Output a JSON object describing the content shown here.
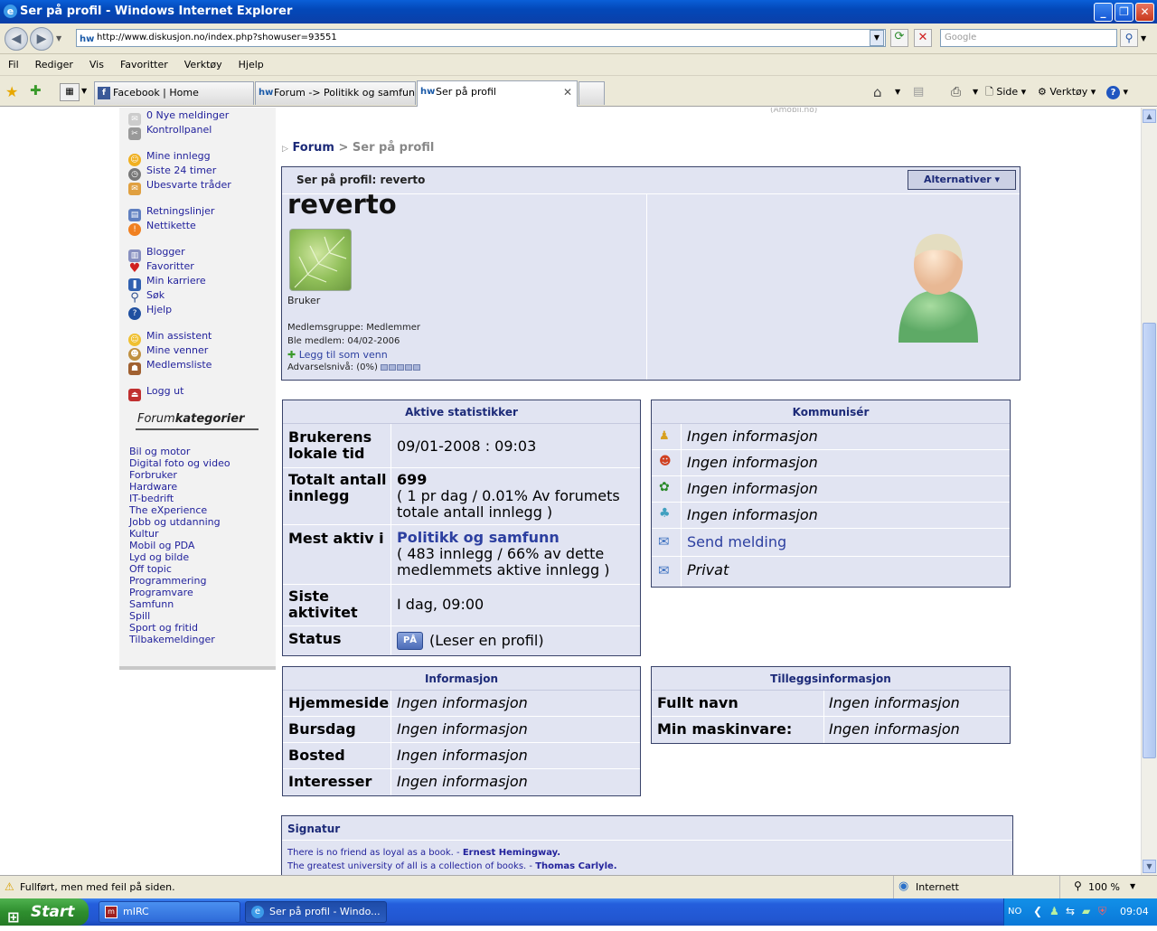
{
  "window": {
    "title": "Ser på profil - Windows Internet Explorer",
    "url": "http://www.diskusjon.no/index.php?showuser=93551",
    "search_placeholder": "Google"
  },
  "menu": [
    "Fil",
    "Rediger",
    "Vis",
    "Favoritter",
    "Verktøy",
    "Hjelp"
  ],
  "tabs": [
    {
      "label": "Facebook | Home",
      "icon": "f"
    },
    {
      "label": "Forum -> Politikk og samfunn",
      "icon": "hw"
    },
    {
      "label": "Ser på profil",
      "icon": "hw"
    }
  ],
  "toolbar": {
    "side": "Side",
    "tools": "Verktøy"
  },
  "top_fade_text": "(Amobil.no)",
  "sidebar": {
    "links": [
      "0 Nye meldinger",
      "Kontrollpanel",
      "Mine innlegg",
      "Siste 24 timer",
      "Ubesvarte tråder",
      "Retningslinjer",
      "Nettikette",
      "Blogger",
      "Favoritter",
      "Min karriere",
      "Søk",
      "Hjelp",
      "Min assistent",
      "Mine venner",
      "Medlemsliste",
      "Logg ut"
    ],
    "category_title_a": "Forum",
    "category_title_b": "kategorier",
    "categories": [
      "Bil og motor",
      "Digital foto og video",
      "Forbruker",
      "Hardware",
      "IT-bedrift",
      "The eXperience",
      "Jobb og utdanning",
      "Kultur",
      "Mobil og PDA",
      "Lyd og bilde",
      "Off topic",
      "Programmering",
      "Programvare",
      "Samfunn",
      "Spill",
      "Sport og fritid",
      "Tilbakemeldinger"
    ]
  },
  "breadcrumb": {
    "root": "Forum",
    "sep": ">",
    "current": "Ser på profil"
  },
  "profile": {
    "header": "Ser på profil: reverto",
    "options_button": "Alternativer",
    "username": "reverto",
    "rank": "Bruker",
    "group": "Medlemsgruppe: Medlemmer",
    "joined": "Ble medlem: 04/02-2006",
    "add_friend": "Legg til som venn",
    "warning": "Advarselsnivå: (0%)"
  },
  "stats": {
    "title": "Aktive statistikker",
    "rows": [
      {
        "label": "Brukerens lokale tid",
        "value": "09/01-2008 : 09:03"
      },
      {
        "label": "Totalt antall innlegg",
        "value": "699",
        "sub": "( 1 pr dag / 0.01% Av forumets totale antall innlegg )"
      },
      {
        "label": "Mest aktiv i",
        "value": "Politikk og samfunn",
        "sub": "( 483 innlegg / 66% av dette medlemmets aktive innlegg )"
      },
      {
        "label": "Siste aktivitet",
        "value": "I dag, 09:00"
      },
      {
        "label": "Status",
        "badge": "PÅ",
        "value": "(Leser en profil)"
      }
    ]
  },
  "communicate": {
    "title": "Kommunisér",
    "rows": [
      {
        "icon": "aim-icon",
        "value": "Ingen informasjon"
      },
      {
        "icon": "yahoo-icon",
        "value": "Ingen informasjon"
      },
      {
        "icon": "icq-icon",
        "value": "Ingen informasjon"
      },
      {
        "icon": "msn-icon",
        "value": "Ingen informasjon"
      },
      {
        "icon": "mail-icon",
        "value": "Send melding"
      },
      {
        "icon": "mail-icon",
        "value": "Privat"
      }
    ]
  },
  "info": {
    "title": "Informasjon",
    "rows": [
      {
        "label": "Hjemmeside",
        "value": "Ingen informasjon"
      },
      {
        "label": "Bursdag",
        "value": "Ingen informasjon"
      },
      {
        "label": "Bosted",
        "value": "Ingen informasjon"
      },
      {
        "label": "Interesser",
        "value": "Ingen informasjon"
      }
    ]
  },
  "extra": {
    "title": "Tilleggsinformasjon",
    "rows": [
      {
        "label": "Fullt navn",
        "value": "Ingen informasjon"
      },
      {
        "label": "Min maskinvare:",
        "value": "Ingen informasjon"
      }
    ]
  },
  "signature": {
    "title": "Signatur",
    "line1": "There is no friend as loyal as a book. -",
    "author1": "Ernest Hemingway.",
    "line2": "The greatest university of all is a collection of books. -",
    "author2": "Thomas Carlyle."
  },
  "statusbar": {
    "text": "Fullført, men med feil på siden.",
    "zone": "Internett",
    "zoom": "100 %"
  },
  "taskbar": {
    "start": "Start",
    "items": [
      "mIRC",
      "Ser på profil - Windo..."
    ],
    "lang": "NO",
    "clock": "09:04"
  },
  "colors": {
    "link": "#22229c",
    "panel_border": "#39436a",
    "panel_bg": "#e1e4f2",
    "heading": "#1c2a78"
  }
}
